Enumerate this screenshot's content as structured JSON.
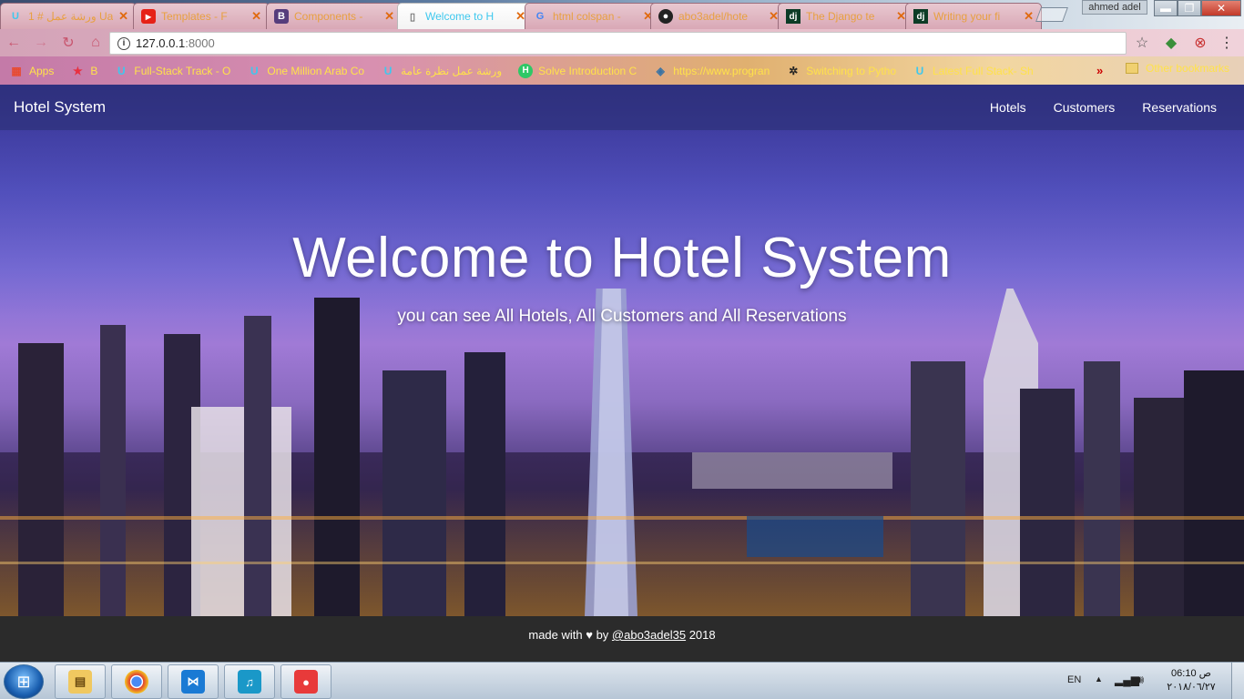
{
  "browser": {
    "tabs": [
      {
        "title": "ورشة عمل # 1 Ua",
        "icon": "udacity-icon",
        "active": false
      },
      {
        "title": "Templates - F",
        "icon": "youtube-icon",
        "active": false
      },
      {
        "title": "Components -",
        "icon": "bootstrap-icon",
        "active": false
      },
      {
        "title": "Welcome to H",
        "icon": "page-icon",
        "active": true
      },
      {
        "title": "html colspan -",
        "icon": "google-icon",
        "active": false
      },
      {
        "title": "abo3adel/hote",
        "icon": "github-icon",
        "active": false
      },
      {
        "title": "The Django te",
        "icon": "django-icon",
        "active": false
      },
      {
        "title": "Writing your fi",
        "icon": "django-icon",
        "active": false
      }
    ],
    "user": "ahmed adel",
    "url_host": "127.0.0.1",
    "url_port": ":8000",
    "bookmarks": [
      {
        "label": "Apps",
        "icon": "apps-grid-icon"
      },
      {
        "label": "B",
        "icon": "star-icon"
      },
      {
        "label": "Full-Stack Track - O",
        "icon": "udacity-icon"
      },
      {
        "label": "One Million Arab Co",
        "icon": "udacity-icon"
      },
      {
        "label": "ورشة عمل نظرة عامة",
        "icon": "udacity-icon"
      },
      {
        "label": "Solve Introduction C",
        "icon": "hackerrank-icon"
      },
      {
        "label": "https://www.progran",
        "icon": "python-icon"
      },
      {
        "label": "Switching to Pytho",
        "icon": "python-icon"
      },
      {
        "label": "Latest Full Stack- Sh",
        "icon": "udacity-icon"
      }
    ],
    "bookmarks_more": "»",
    "other_bookmarks": "Other bookmarks"
  },
  "site": {
    "brand": "Hotel System",
    "nav": [
      "Hotels",
      "Customers",
      "Reservations"
    ],
    "hero_title": "Welcome to Hotel System",
    "hero_subtitle": "you can see All Hotels, All Customers and All Reservations",
    "footer_prefix": "made with ♥ by",
    "footer_link": "@abo3adel35",
    "footer_year": "2018"
  },
  "taskbar": {
    "apps": [
      "file-explorer-icon",
      "chrome-icon",
      "vscode-icon",
      "media-player-icon",
      "recorder-icon"
    ],
    "lang": "EN",
    "time": "06:10 ص",
    "date": "٢٠١٨/٠٦/٢٧"
  },
  "colors": {
    "nav_bg": "#282d6e",
    "footer_bg": "#2b2b2b",
    "active_tab_text": "#3ec8ee",
    "bookmark_text": "#ffe24a"
  }
}
